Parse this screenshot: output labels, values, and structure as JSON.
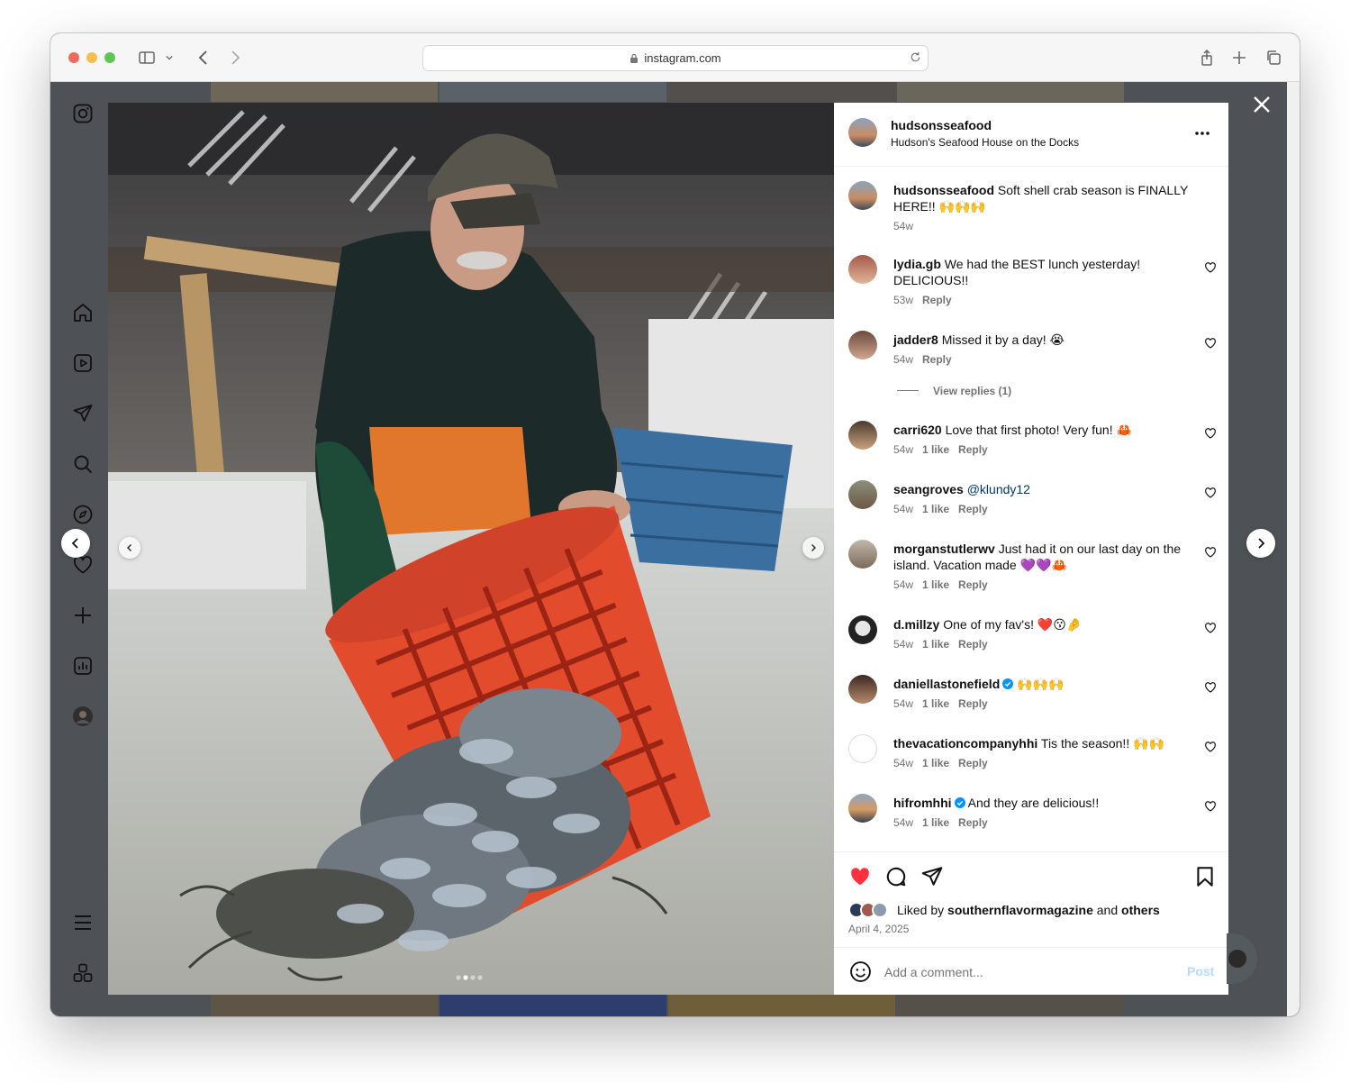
{
  "browser": {
    "url": "instagram.com",
    "traffic_lights": [
      "#ed6a5e",
      "#f5bf4f",
      "#61c554"
    ]
  },
  "sidebar": {
    "items": [
      {
        "icon": "instagram-logo-icon"
      },
      {
        "icon": "home-icon"
      },
      {
        "icon": "reels-icon"
      },
      {
        "icon": "messages-icon"
      },
      {
        "icon": "search-icon"
      },
      {
        "icon": "explore-icon"
      },
      {
        "icon": "notifications-heart-icon"
      },
      {
        "icon": "create-plus-icon"
      },
      {
        "icon": "dashboard-icon"
      },
      {
        "icon": "profile-avatar"
      },
      {
        "icon": "menu-icon"
      },
      {
        "icon": "more-apps-icon"
      }
    ]
  },
  "post": {
    "username": "hudsonsseafood",
    "location": "Hudson's Seafood House on the Docks",
    "caption_user": "hudsonsseafood",
    "caption_text": "Soft shell crab season is FINALLY HERE!! 🙌🙌🙌",
    "caption_time": "54w",
    "carousel": {
      "current": 2,
      "total": 4
    }
  },
  "comments": [
    {
      "user": "lydia.gb",
      "text": "We had the BEST lunch yesterday! DELICIOUS!!",
      "time": "53w",
      "likes": "",
      "reply": "Reply"
    },
    {
      "user": "jadder8",
      "text": "Missed it by a day! 😭",
      "time": "54w",
      "likes": "",
      "reply": "Reply",
      "view_replies": "View replies (1)"
    },
    {
      "user": "carri620",
      "text": "Love that first photo! Very fun! 🦀",
      "time": "54w",
      "likes": "1 like",
      "reply": "Reply"
    },
    {
      "user": "seangroves",
      "mention": "@klundy12",
      "text": "",
      "time": "54w",
      "likes": "1 like",
      "reply": "Reply"
    },
    {
      "user": "morganstutlerwv",
      "text": "Just had it on our last day on the island. Vacation made 💜💜🦀",
      "time": "54w",
      "likes": "1 like",
      "reply": "Reply"
    },
    {
      "user": "d.millzy",
      "text": "One of my fav's! ❤️😗🤌",
      "time": "54w",
      "likes": "1 like",
      "reply": "Reply"
    },
    {
      "user": "daniellastonefield",
      "verified": true,
      "text": "🙌🙌🙌",
      "time": "54w",
      "likes": "1 like",
      "reply": "Reply"
    },
    {
      "user": "thevacationcompanyhhi",
      "text": "Tis the season!! 🙌🙌",
      "time": "54w",
      "likes": "1 like",
      "reply": "Reply"
    },
    {
      "user": "hifromhhi",
      "verified": true,
      "text": "And they are delicious!!",
      "time": "54w",
      "likes": "1 like",
      "reply": "Reply"
    }
  ],
  "actions": {
    "liked_prefix": "Liked by",
    "liked_user": "southernflavormagazine",
    "liked_and": "and",
    "liked_others": "others",
    "date": "April 4, 2025",
    "liked": true,
    "like_color": "#ff3040"
  },
  "add_comment": {
    "placeholder": "Add a comment...",
    "post_label": "Post"
  }
}
